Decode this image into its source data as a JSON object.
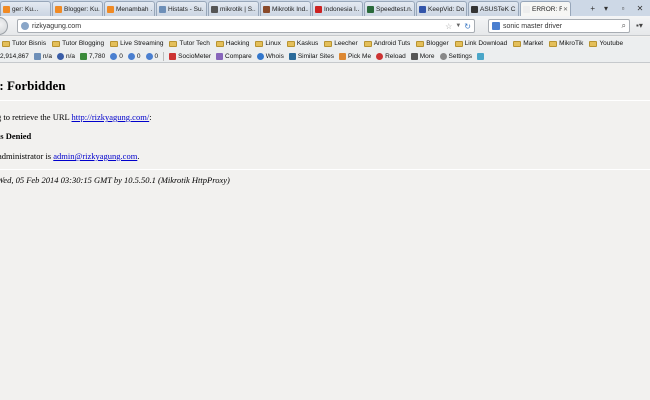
{
  "browser": {
    "tabs": [
      {
        "label": "ger: Ku...",
        "color": "#f08a24"
      },
      {
        "label": "Blogger: Ku...",
        "color": "#f08a24"
      },
      {
        "label": "Menambah ...",
        "color": "#f08a24"
      },
      {
        "label": "Histats - Su...",
        "color": "#6d8fb8"
      },
      {
        "label": "mikrotik | S...",
        "color": "#555555"
      },
      {
        "label": "Mikrotik Ind...",
        "color": "#8a4a2a"
      },
      {
        "label": "Indonesia I...",
        "color": "#cc2222"
      },
      {
        "label": "Speedtest.n...",
        "color": "#2a6a3a"
      },
      {
        "label": "KeepVid: Do...",
        "color": "#3355aa"
      },
      {
        "label": "ASUSTeK C...",
        "color": "#333333"
      },
      {
        "label": "ERROR: F...",
        "color": "#eeeeee",
        "active": true
      }
    ],
    "new_tab": "+",
    "url": "rizkyagung.com",
    "search_value": "sonic master driver"
  },
  "bookmarks": [
    "Tutor Bisnis",
    "Tutor Blogging",
    "Live Streaming",
    "Tutor Tech",
    "Hacking",
    "Linux",
    "Kaskus",
    "Leecher",
    "Android Tuts",
    "Blogger",
    "Link Download",
    "Market",
    "MikroTik",
    "Youtube"
  ],
  "addons": {
    "stat1": "2,914,867",
    "stat2": "n/a",
    "stat3": "n/a",
    "stat4": "7,780",
    "stat5": "0",
    "stat6": "0",
    "stat7": "0",
    "seomoz": "SocioMeter",
    "compare": "Compare",
    "whois": "Whois",
    "similar": "Similar Sites",
    "pickme": "Pick Me",
    "reload": "Reload",
    "more": "More",
    "settings": "Settings"
  },
  "page": {
    "heading": "R: Forbidden",
    "retrieve_prefix": "g to retrieve the URL ",
    "retrieve_link": "http://rizkyagung.com/",
    "retrieve_suffix": ":",
    "denied": "ss Denied",
    "admin_prefix": "administrator is ",
    "admin_email": "admin@rizkyagung.com",
    "admin_suffix": ".",
    "footer": "Wed, 05 Feb 2014 03:30:15 GMT by 10.5.50.1 (Mikrotik HttpProxy)"
  }
}
